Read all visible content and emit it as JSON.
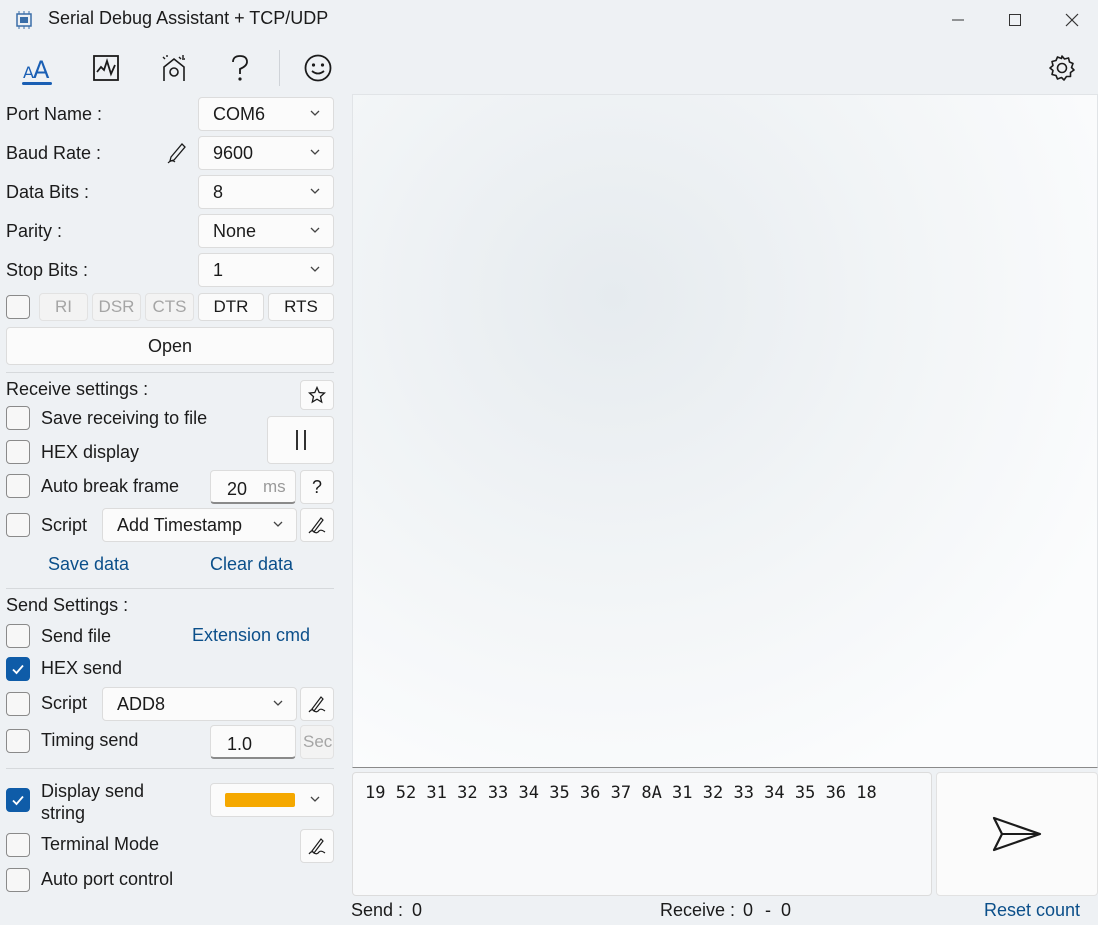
{
  "window": {
    "title": "Serial Debug Assistant + TCP/UDP"
  },
  "toolbar": {
    "items": [
      {
        "name": "text-mode-icon"
      },
      {
        "name": "chart-icon"
      },
      {
        "name": "tools-icon"
      },
      {
        "name": "help-icon"
      },
      {
        "name": "smiley-icon"
      },
      {
        "name": "settings-icon"
      }
    ]
  },
  "serial": {
    "port_label": "Port Name :",
    "port_value": "COM6",
    "baud_label": "Baud Rate :",
    "baud_value": "9600",
    "databits_label": "Data Bits :",
    "databits_value": "8",
    "parity_label": "Parity :",
    "parity_value": "None",
    "stopbits_label": "Stop Bits :",
    "stopbits_value": "1",
    "signals": {
      "ri": "RI",
      "dsr": "DSR",
      "cts": "CTS",
      "dtr": "DTR",
      "rts": "RTS"
    },
    "open_label": "Open"
  },
  "receive": {
    "heading": "Receive settings :",
    "save_to_file": "Save receiving to file",
    "hex_display": "HEX display",
    "auto_break": "Auto break frame",
    "break_value": "20",
    "break_unit": "ms",
    "help": "?",
    "script_label": "Script",
    "script_value": "Add Timestamp",
    "save_data": "Save data",
    "clear_data": "Clear data"
  },
  "send": {
    "heading": "Send Settings :",
    "send_file": "Send file",
    "extension_cmd": "Extension cmd",
    "hex_send": "HEX send",
    "hex_send_checked": true,
    "script_label": "Script",
    "script_value": "ADD8",
    "timing_send": "Timing send",
    "timing_value": "1.0",
    "timing_unit": "Sec",
    "display_send_string": "Display send string",
    "display_send_checked": true,
    "display_color": "#f5a800",
    "terminal_mode": "Terminal Mode",
    "auto_port_control": "Auto port control",
    "payload": "19 52 31 32 33 34 35 36 37 8A 31 32 33 34 35 36 18"
  },
  "status": {
    "send_label": "Send :",
    "send_count": "0",
    "receive_label": "Receive :",
    "receive_count_a": "0",
    "receive_sep": "-",
    "receive_count_b": "0",
    "reset": "Reset count"
  },
  "colors": {
    "accent": "#0f5ca8",
    "link": "#0b4f8a"
  }
}
